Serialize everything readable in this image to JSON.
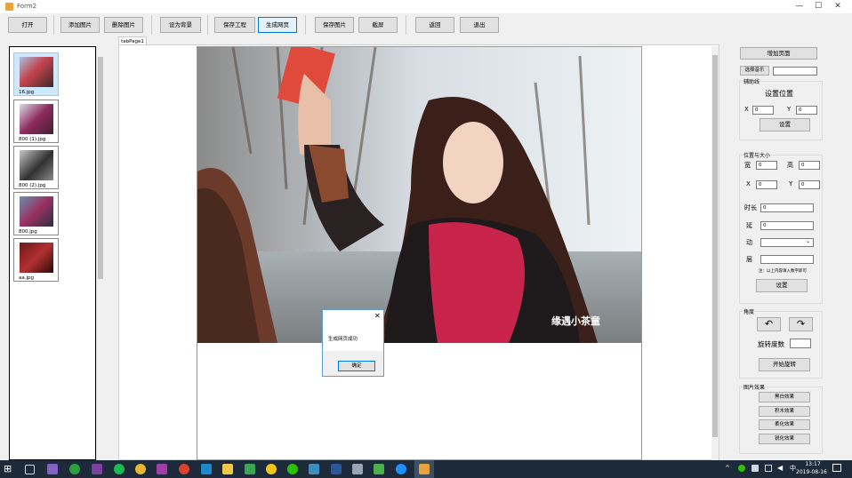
{
  "window": {
    "title": "Form2",
    "minimize": "—",
    "maximize": "☐",
    "close": "✕"
  },
  "toolbar": {
    "open": "打开",
    "add_image": "添加图片",
    "delete_image": "删除图片",
    "set_background": "设为背景",
    "save_project": "保存工程",
    "generate_page": "生成网页",
    "save_image": "保存图片",
    "screenshot": "截屏",
    "back": "返回",
    "exit": "退出"
  },
  "thumbnails": [
    {
      "label": "16.jpg",
      "selected": true
    },
    {
      "label": "800 (1).jpg",
      "selected": false
    },
    {
      "label": "800 (2).jpg",
      "selected": false
    },
    {
      "label": "800.jpg",
      "selected": false
    },
    {
      "label": "aa.jpg",
      "selected": false
    }
  ],
  "tab": {
    "label": "tabPage1"
  },
  "photo": {
    "watermark": "缘遇小茶童"
  },
  "dialog": {
    "message": "生成网页成功",
    "ok": "确定",
    "close": "✕"
  },
  "right": {
    "add_page": "增加页面",
    "select_music": "选择音乐",
    "music_value": "",
    "auxline": {
      "group": "辅助线",
      "heading": "设置位置",
      "x_label": "X",
      "x_value": "0",
      "y_label": "Y",
      "y_value": "0",
      "set": "设置"
    },
    "possize": {
      "group": "位置与大小",
      "width_label": "宽",
      "width_value": "0",
      "height_label": "高",
      "height_value": "0",
      "x_label": "X",
      "x_value": "0",
      "y_label": "Y",
      "y_value": "0",
      "duration_label": "时长",
      "duration_value": "0",
      "delay_label": "延",
      "delay_value": "0",
      "anim_label": "动",
      "anim_value": "",
      "layer_label": "层",
      "layer_value": "",
      "note": "注：以上内容填入数字即可",
      "set": "设置"
    },
    "angle": {
      "group": "角度",
      "rotate_left": "↶",
      "rotate_right": "↷",
      "degree_label": "旋转度数",
      "degree_value": "",
      "start": "开始旋转"
    },
    "effects": {
      "group": "图片效果",
      "items": [
        "黑白效果",
        "积木效果",
        "柔化效果",
        "锐化效果"
      ]
    }
  },
  "taskbar": {
    "time": "13:17",
    "date": "2019-08-16",
    "lang": "中"
  }
}
